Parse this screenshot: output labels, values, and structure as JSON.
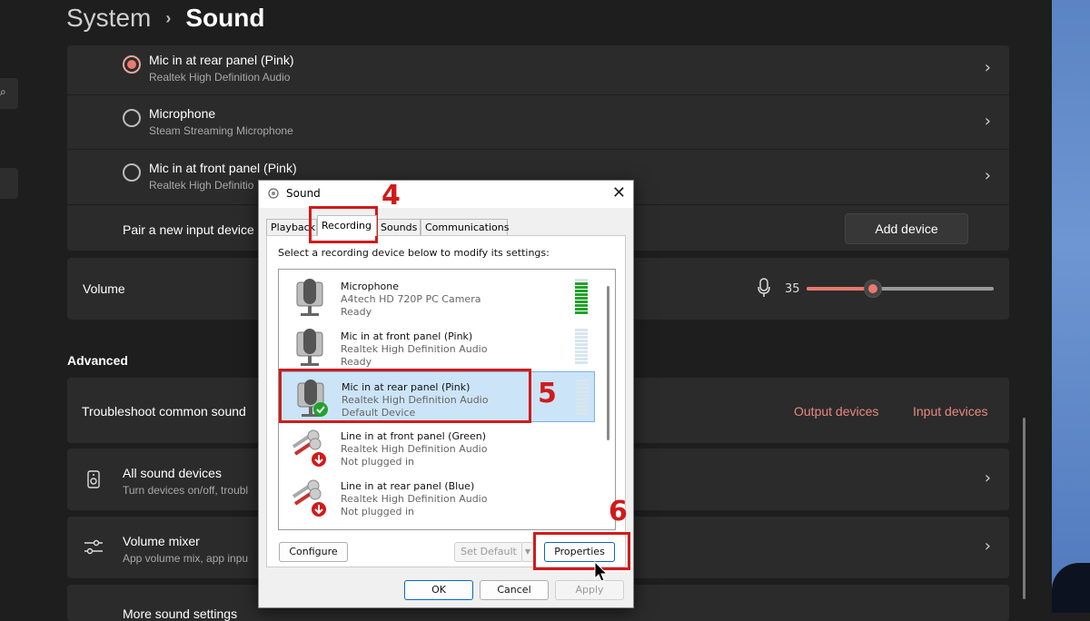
{
  "header": {
    "section": "System",
    "page": "Sound"
  },
  "input_devices": [
    {
      "name": "Mic in at rear panel (Pink)",
      "desc": "Realtek High Definition Audio",
      "selected": true
    },
    {
      "name": "Microphone",
      "desc": "Steam Streaming Microphone",
      "selected": false
    },
    {
      "name": "Mic in at front panel (Pink)",
      "desc": "Realtek High Definitio",
      "selected": false
    }
  ],
  "pair_row": {
    "label": "Pair a new input device",
    "button": "Add device"
  },
  "volume": {
    "label": "Volume",
    "value": "35",
    "level_percent": 35
  },
  "advanced": {
    "title": "Advanced",
    "troubleshoot": {
      "label": "Troubleshoot common sound",
      "output_link": "Output devices",
      "input_link": "Input devices"
    },
    "all_devices": {
      "title": "All sound devices",
      "desc": "Turn devices on/off, troubl"
    },
    "volume_mixer": {
      "title": "Volume mixer",
      "desc": "App volume mix, app inpu"
    },
    "more": {
      "title": "More sound settings"
    }
  },
  "dialog": {
    "title": "Sound",
    "tabs": [
      "Playback",
      "Recording",
      "Sounds",
      "Communications"
    ],
    "active_tab": "Recording",
    "instruction": "Select a recording device below to modify its settings:",
    "devices": [
      {
        "name": "Microphone",
        "desc": "A4tech HD 720P PC Camera",
        "status": "Ready",
        "icon": "microphone-icon",
        "meter_level": 0.9
      },
      {
        "name": "Mic in at front panel (Pink)",
        "desc": "Realtek High Definition Audio",
        "status": "Ready",
        "icon": "microphone-icon",
        "meter_level": 0
      },
      {
        "name": "Mic in at rear panel (Pink)",
        "desc": "Realtek High Definition Audio",
        "status": "Default Device",
        "icon": "microphone-default-icon",
        "meter_level": 0,
        "selected": true
      },
      {
        "name": "Line in at front panel (Green)",
        "desc": "Realtek High Definition Audio",
        "status": "Not plugged in",
        "icon": "rca-cable-icon"
      },
      {
        "name": "Line in at rear panel (Blue)",
        "desc": "Realtek High Definition Audio",
        "status": "Not plugged in",
        "icon": "rca-cable-icon"
      }
    ],
    "buttons": {
      "configure": "Configure",
      "set_default": "Set Default",
      "properties": "Properties",
      "ok": "OK",
      "cancel": "Cancel",
      "apply": "Apply"
    }
  },
  "callouts": [
    "4",
    "5",
    "6"
  ],
  "colors": {
    "accent": "#e87b6e",
    "callout": "#d11a1a",
    "meter_green": "#22a22a"
  }
}
